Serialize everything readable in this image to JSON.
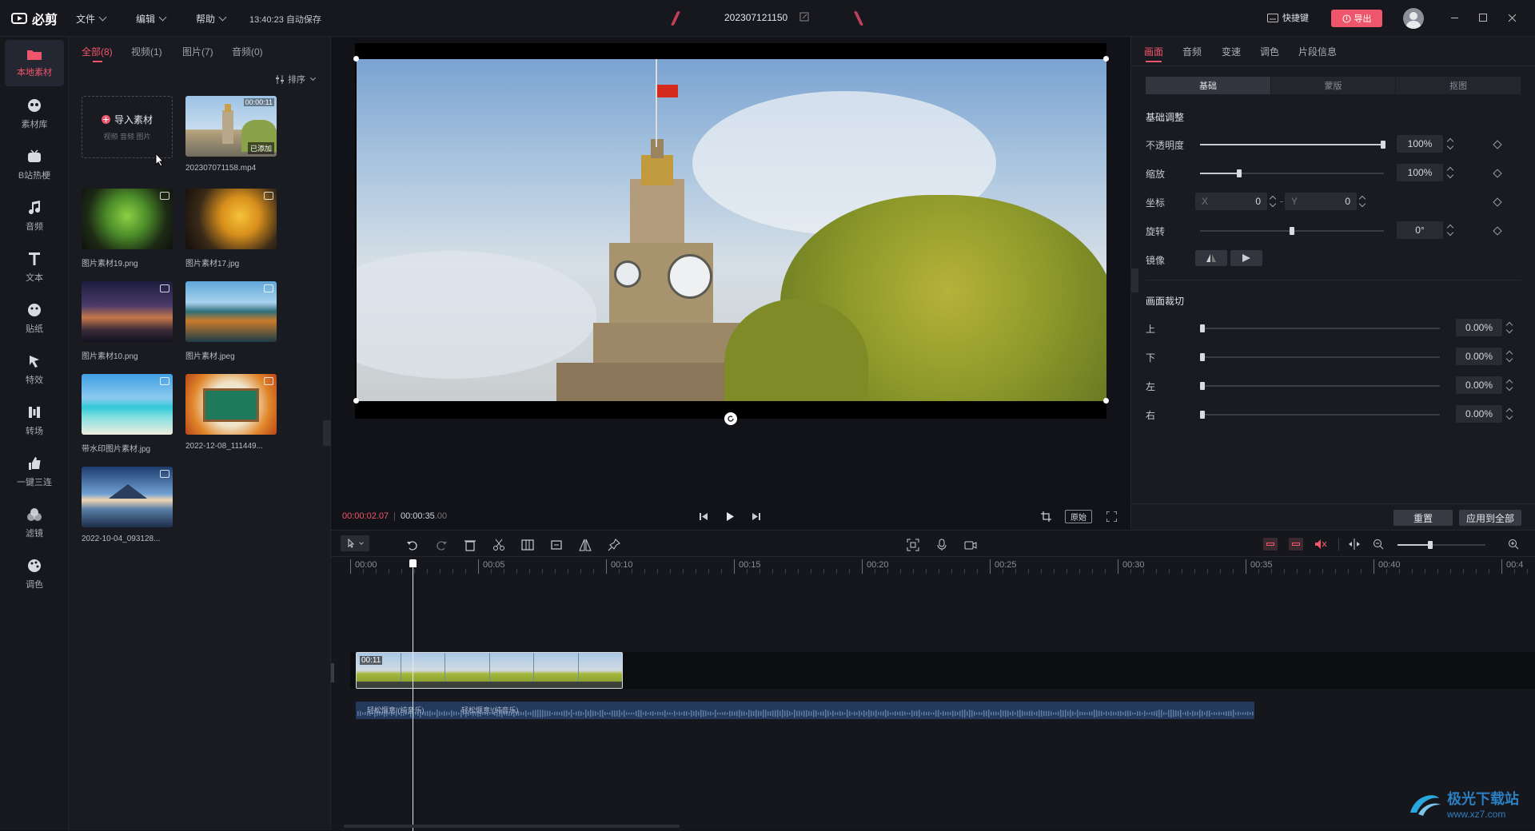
{
  "app": {
    "logo_text": "必剪",
    "menus": [
      "文件",
      "编辑",
      "帮助"
    ],
    "autosave": "13:40:23 自动保存",
    "project_name": "202307121150",
    "shortcut_label": "快捷键",
    "export_label": "导出",
    "accent": "#f0566b"
  },
  "rail": {
    "items": [
      {
        "label": "本地素材",
        "icon": "folder-icon"
      },
      {
        "label": "素材库",
        "icon": "material-icon"
      },
      {
        "label": "B站热梗",
        "icon": "tv-icon"
      },
      {
        "label": "音频",
        "icon": "music-icon"
      },
      {
        "label": "文本",
        "icon": "text-icon"
      },
      {
        "label": "贴纸",
        "icon": "sticker-icon"
      },
      {
        "label": "特效",
        "icon": "effect-icon"
      },
      {
        "label": "转场",
        "icon": "transition-icon"
      },
      {
        "label": "一键三连",
        "icon": "thumb-up-icon"
      },
      {
        "label": "滤镜",
        "icon": "filter-icon"
      },
      {
        "label": "调色",
        "icon": "palette-icon"
      }
    ]
  },
  "media": {
    "tabs": [
      "全部(8)",
      "视频(1)",
      "图片(7)",
      "音频(0)"
    ],
    "sort_label": "排序",
    "import": {
      "label": "导入素材",
      "hint": "视频 音频 图片"
    },
    "items": [
      {
        "name": "202307071158.mp4",
        "duration": "00:00:11",
        "tag": "已添加"
      },
      {
        "name": "图片素材19.png"
      },
      {
        "name": "图片素材17.jpg"
      },
      {
        "name": "图片素材10.png"
      },
      {
        "name": "图片素材.jpeg"
      },
      {
        "name": "带水印图片素材.jpg"
      },
      {
        "name": "2022-12-08_111449..."
      },
      {
        "name": "2022-10-04_093128..."
      }
    ]
  },
  "preview": {
    "current_time": "00:00:02.07",
    "total_time": "00:00:35",
    "total_time_ms": ".00",
    "ratio_label": "原始"
  },
  "inspector": {
    "tabs": [
      "画面",
      "音频",
      "变速",
      "调色",
      "片段信息"
    ],
    "subtabs": [
      "基础",
      "蒙版",
      "抠图"
    ],
    "basic_title": "基础调整",
    "opacity": {
      "label": "不透明度",
      "value": "100%"
    },
    "scale": {
      "label": "缩放",
      "value": "100%"
    },
    "position": {
      "label": "坐标",
      "x_label": "X",
      "x": "0",
      "y_label": "Y",
      "y": "0"
    },
    "rotation": {
      "label": "旋转",
      "value": "0°"
    },
    "mirror_label": "镜像",
    "crop_title": "画面裁切",
    "crop": [
      {
        "label": "上",
        "value": "0.00%"
      },
      {
        "label": "下",
        "value": "0.00%"
      },
      {
        "label": "左",
        "value": "0.00%"
      },
      {
        "label": "右",
        "value": "0.00%"
      }
    ],
    "reset_label": "重置",
    "apply_all_label": "应用到全部"
  },
  "timeline": {
    "ticks": [
      "00:00",
      "00:05",
      "00:10",
      "00:15",
      "00:20",
      "00:25",
      "00:30",
      "00:35",
      "00:40",
      "00:4"
    ],
    "clip_duration": "00:11",
    "audio_labels": [
      "轻松惬意!(纯音乐)",
      "轻松惬意!(纯音乐)"
    ]
  },
  "watermark": {
    "text": "极光下载站",
    "url": "www.xz7.com"
  }
}
